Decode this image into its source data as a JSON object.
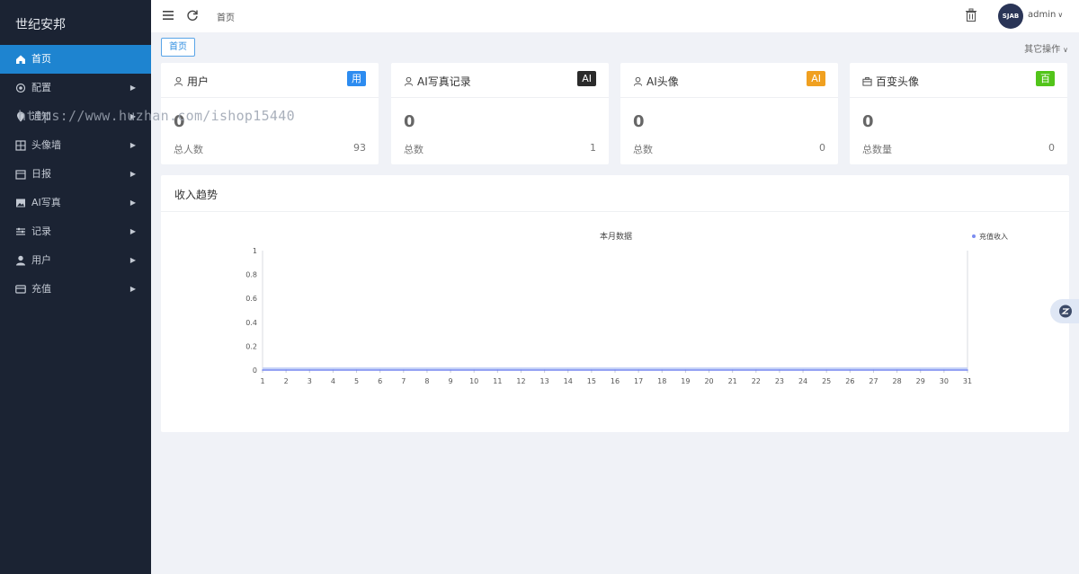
{
  "sidebar": {
    "brand": "世纪安邦",
    "items": [
      {
        "label": "首页",
        "icon": "home-icon",
        "active": true,
        "arrow": false
      },
      {
        "label": "配置",
        "icon": "gear-icon",
        "active": false,
        "arrow": true
      },
      {
        "label": "通知",
        "icon": "pin-icon",
        "active": false,
        "arrow": true
      },
      {
        "label": "头像墙",
        "icon": "grid-icon",
        "active": false,
        "arrow": true
      },
      {
        "label": "日报",
        "icon": "calendar-icon",
        "active": false,
        "arrow": true
      },
      {
        "label": "AI写真",
        "icon": "image-icon",
        "active": false,
        "arrow": true
      },
      {
        "label": "记录",
        "icon": "sliders-icon",
        "active": false,
        "arrow": true
      },
      {
        "label": "用户",
        "icon": "user-icon",
        "active": false,
        "arrow": true
      },
      {
        "label": "充值",
        "icon": "card-icon",
        "active": false,
        "arrow": true
      }
    ]
  },
  "watermark": "https://www.huzhan.com/ishop15440",
  "header": {
    "breadcrumb": "首页",
    "user_name": "admin",
    "avatar_text": "SJAB"
  },
  "tabs": {
    "home": "首页",
    "other_ops": "其它操作"
  },
  "cards": [
    {
      "title": "用户",
      "badge": "用",
      "badge_color": "#2d8cf0",
      "icon": "user-icon",
      "value": "0",
      "foot_label": "总人数",
      "foot_value": "93"
    },
    {
      "title": "AI写真记录",
      "badge": "AI",
      "badge_color": "#2b2b2b",
      "icon": "user-icon",
      "value": "0",
      "foot_label": "总数",
      "foot_value": "1"
    },
    {
      "title": "AI头像",
      "badge": "AI",
      "badge_color": "#f0a020",
      "icon": "user-icon",
      "value": "0",
      "foot_label": "总数",
      "foot_value": "0"
    },
    {
      "title": "百变头像",
      "badge": "百",
      "badge_color": "#52c41a",
      "icon": "briefcase-icon",
      "value": "0",
      "foot_label": "总数量",
      "foot_value": "0"
    }
  ],
  "trend": {
    "title": "收入趋势"
  },
  "chart_data": {
    "type": "line",
    "title": "本月数据",
    "x": [
      1,
      2,
      3,
      4,
      5,
      6,
      7,
      8,
      9,
      10,
      11,
      12,
      13,
      14,
      15,
      16,
      17,
      18,
      19,
      20,
      21,
      22,
      23,
      24,
      25,
      26,
      27,
      28,
      29,
      30,
      31
    ],
    "series": [
      {
        "name": "充值收入",
        "color": "#7b8cf0",
        "values": [
          0,
          0,
          0,
          0,
          0,
          0,
          0,
          0,
          0,
          0,
          0,
          0,
          0,
          0,
          0,
          0,
          0,
          0,
          0,
          0,
          0,
          0,
          0,
          0,
          0,
          0,
          0,
          0,
          0,
          0,
          0
        ]
      }
    ],
    "ylim": [
      0,
      1
    ],
    "yticks": [
      0,
      0.2,
      0.4,
      0.6,
      0.8,
      1
    ],
    "legend": "top-right"
  }
}
